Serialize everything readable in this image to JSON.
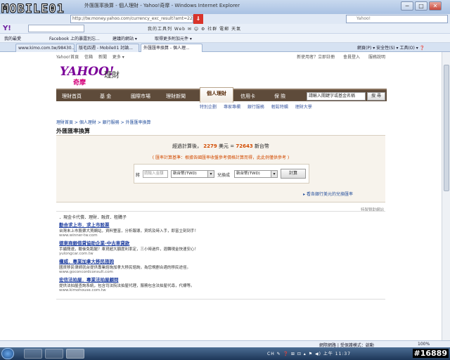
{
  "watermark": {
    "logo": "MOBILE01",
    "id": "#16889"
  },
  "window": {
    "title": "外匯匯率換算 - 個人理財 - Yahoo!奇摩 - Windows Internet Explorer",
    "min": "─",
    "max": "□",
    "close": "✕"
  },
  "address": {
    "url": "http://tw.money.yahoo.com/currency_exc_result?amt=2279&from=USD&to=TWD",
    "search_placeholder": "Yahoo!"
  },
  "toolbar": {
    "yahoo": "Y!",
    "items": "我的工具列   Web   ✉   ☺   ⚙   社群   電郵   天氣"
  },
  "favbar": {
    "items": [
      "我的最愛",
      "Facebook 上的暴露別忘...",
      "建議的網站 ▾",
      "取得更多附加元件 ▾"
    ]
  },
  "tabs": [
    {
      "label": "www.kimo.com.tw/98430..."
    },
    {
      "label": "版毛四週 - Mobile01 討論..."
    },
    {
      "label": "外匯匯率換算 - 個人理...",
      "active": true
    }
  ],
  "cmdbar": {
    "items": "網頁(P) ▾   安全性(S) ▾   工具(O) ▾   ❓"
  },
  "ytop": {
    "left": [
      "Yahoo!首頁",
      "信箱",
      "新聞",
      "更多 ▾"
    ],
    "right": [
      "新使用者？立即註冊",
      "會員登入",
      "服務說明"
    ]
  },
  "ylogo": {
    "main": "YAHOO!",
    "sub": "奇摩",
    "section": "理財"
  },
  "mainnav": {
    "items": [
      "理財首頁",
      "基 金",
      "國際市場",
      "理財新聞",
      "個人理財",
      "信用卡",
      "保 險"
    ],
    "search_placeholder": "請輸入關鍵字或基金名稱",
    "search_btn": "搜 尋"
  },
  "subnav": [
    "特別企劃",
    "專家專欄",
    "銀行服務",
    "輕鬆特輯",
    "理財大學"
  ],
  "breadcrumb": "理財首頁 > 個人理財 > 銀行服務 > 外匯匯率換算",
  "page_title": "外匯匯率換算",
  "calc": {
    "result_prefix": "經過計算後，",
    "amount": "2279",
    "from_unit": "美元 =",
    "value": "72643",
    "to_unit": "新台幣",
    "note": "( 匯率計算基準：根據各國匯率收盤參考價格計算而得，此此例僅供參考 )",
    "amount_label": "將",
    "amount_placeholder": "請輸入金額",
    "from_currency": "新台幣(TWD)",
    "convert_label": "兌換成",
    "to_currency": "新台幣(TWD)",
    "button": "計算",
    "link": "▸ 看各銀行美元的兌換匯率"
  },
  "ads": {
    "sponsor": "特製贊助網站",
    "header": "．現金卡代償．理財．融資．租購子",
    "items": [
      {
        "title": "勤合求上市．求上市股票",
        "desc": "台灣未上市股票大買網站，資料豐富，分析報導，資訊及時入手，即富立刻到手！",
        "url": "www.winner-tw.com"
      },
      {
        "title": "德東商銀借貸協助企業-中古車貸款",
        "desc": "手續簡速，驗後免跑腿？車貸超大額度利率定，三小時過件，週轉現金快速安心！",
        "url": "yulongcar.com.tw"
      },
      {
        "title": "權威．專業加拿大移民諮詢",
        "desc": "國資移民律師就台提供專業諮詢加拿大移民諮詢，為您規劃合適的移民途徑。",
        "url": "www.goconcordconsult.com"
      },
      {
        "title": "宏信法拍屋．專業法拍屋顧問",
        "desc": "提供法拍屋查詢系統，包含司法院法拍屋代理，服務包含法拍屋代尋，代標等。",
        "url": "www.kimohouse.com.tw"
      }
    ]
  },
  "status": {
    "zone": "網際網路 | 受保護模式：啟動",
    "zoom": "100%"
  },
  "tray": "CH ✎ ❓ ⊞ ⊡ ▴ ⚑ ◀) 上午 11:37",
  "colors": {
    "nav": "#5e4b3a",
    "accent": "#d24b00",
    "link": "#1f4b9a",
    "brand": "#7b0099"
  }
}
